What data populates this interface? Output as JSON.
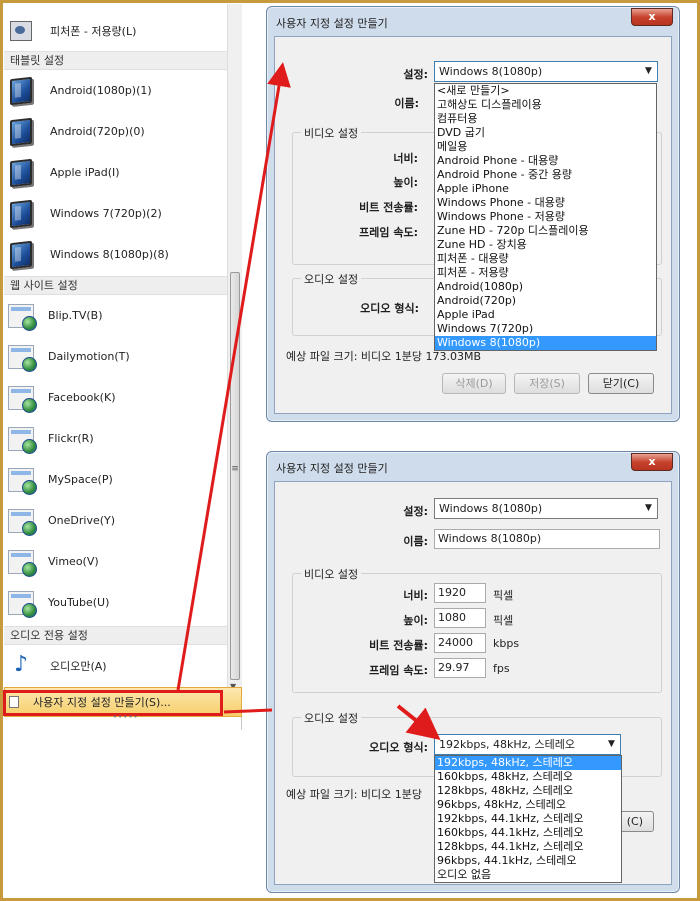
{
  "menu": {
    "top_item": {
      "label": "피처폰 - 저용량(L)",
      "icon": "phone-icon"
    },
    "tablet_section": "태블릿 설정",
    "tablet_items": [
      {
        "label": "Android(1080p)(1)",
        "icon": "tablet-icon"
      },
      {
        "label": "Android(720p)(0)",
        "icon": "tablet-icon"
      },
      {
        "label": "Apple iPad(I)",
        "icon": "tablet-icon"
      },
      {
        "label": "Windows 7(720p)(2)",
        "icon": "tablet-icon"
      },
      {
        "label": "Windows 8(1080p)(8)",
        "icon": "tablet-icon"
      }
    ],
    "web_section": "웹 사이트 설정",
    "web_items": [
      {
        "label": "Blip.TV(B)",
        "icon": "web-globe-icon"
      },
      {
        "label": "Dailymotion(T)",
        "icon": "web-globe-icon"
      },
      {
        "label": "Facebook(K)",
        "icon": "web-globe-icon"
      },
      {
        "label": "Flickr(R)",
        "icon": "web-globe-icon"
      },
      {
        "label": "MySpace(P)",
        "icon": "web-globe-icon"
      },
      {
        "label": "OneDrive(Y)",
        "icon": "web-globe-icon"
      },
      {
        "label": "Vimeo(V)",
        "icon": "web-globe-icon"
      },
      {
        "label": "YouTube(U)",
        "icon": "web-globe-icon"
      }
    ],
    "audio_section": "오디오 전용 설정",
    "audio_items": [
      {
        "label": "오디오만(A)",
        "icon": "music-note-icon"
      }
    ],
    "custom_item": "사용자 지정 설정 만들기(S)..."
  },
  "dialog_top": {
    "title": "사용자 지정 설정 만들기",
    "close_label": "x",
    "setting_label": "설정:",
    "setting_value": "Windows 8(1080p)",
    "name_label": "이름:",
    "video_group": "비디오 설정",
    "width_label": "너비:",
    "height_label": "높이:",
    "bitrate_label": "비트 전송률:",
    "framerate_label": "프레임 속도:",
    "audio_group": "오디오 설정",
    "audio_format_label": "오디오 형식:",
    "estimate": "예상 파일 크기: 비디오 1분당 173.03MB",
    "delete_label": "삭제(D)",
    "save_label": "저장(S)",
    "close_button_label": "닫기(C)",
    "options": [
      "<새로 만들기>",
      "고해상도 디스플레이용",
      "컴퓨터용",
      "DVD 굽기",
      "메일용",
      "Android Phone - 대용량",
      "Android Phone - 중간 용량",
      "Apple iPhone",
      "Windows Phone - 대용량",
      "Windows Phone - 저용량",
      "Zune HD - 720p 디스플레이용",
      "Zune HD - 장치용",
      "피처폰 - 대용량",
      "피처폰 - 저용량",
      "Android(1080p)",
      "Android(720p)",
      "Apple iPad",
      "Windows 7(720p)",
      "Windows 8(1080p)"
    ],
    "selected_option": "Windows 8(1080p)"
  },
  "dialog_bottom": {
    "title": "사용자 지정 설정 만들기",
    "close_label": "x",
    "setting_label": "설정:",
    "setting_value": "Windows 8(1080p)",
    "name_label": "이름:",
    "name_value": "Windows 8(1080p)",
    "video_group": "비디오 설정",
    "width_label": "너비:",
    "width_value": "1920",
    "width_unit": "픽셀",
    "height_label": "높이:",
    "height_value": "1080",
    "height_unit": "픽셀",
    "bitrate_label": "비트 전송률:",
    "bitrate_value": "24000",
    "bitrate_unit": "kbps",
    "framerate_label": "프레임 속도:",
    "framerate_value": "29.97",
    "framerate_unit": "fps",
    "audio_group": "오디오 설정",
    "audio_format_label": "오디오 형식:",
    "audio_format_value": "192kbps, 48kHz, 스테레오",
    "estimate": "예상 파일 크기: 비디오 1분당",
    "close_button_label": "(C)",
    "audio_options": [
      "192kbps, 48kHz, 스테레오",
      "160kbps, 48kHz, 스테레오",
      "128kbps, 48kHz, 스테레오",
      "96kbps, 48kHz, 스테레오",
      "192kbps, 44.1kHz, 스테레오",
      "160kbps, 44.1kHz, 스테레오",
      "128kbps, 44.1kHz, 스테레오",
      "96kbps, 44.1kHz, 스테레오",
      "오디오 없음"
    ],
    "selected_audio_option": "192kbps, 48kHz, 스테레오"
  },
  "colors": {
    "annotation_red": "#e01b1b",
    "highlight_blue": "#3399ff",
    "frame_gold": "#c89a3e"
  }
}
